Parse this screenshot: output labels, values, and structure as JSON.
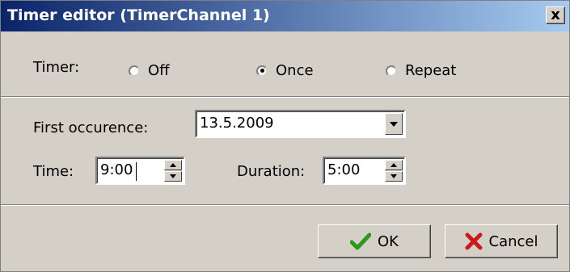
{
  "window": {
    "title": "Timer editor (TimerChannel 1)",
    "close_label": "x"
  },
  "timer": {
    "label": "Timer:",
    "options": [
      "Off",
      "Once",
      "Repeat"
    ],
    "selected": "Once"
  },
  "first_occurrence": {
    "label": "First occurence:",
    "value": "13.5.2009"
  },
  "time": {
    "label": "Time:",
    "value": "9:00"
  },
  "duration": {
    "label": "Duration:",
    "value": "5:00"
  },
  "buttons": {
    "ok_label": "OK",
    "cancel_label": "Cancel"
  },
  "colors": {
    "title_bar_start": "#0a246a",
    "title_bar_end": "#a6caf0",
    "dialog_face": "#d4d0c8",
    "ok_check": "#2a9a1a",
    "cancel_x": "#cc1a1a"
  },
  "icons": {
    "ok": "check-icon",
    "cancel": "x-icon",
    "dropdown": "chevron-down-icon",
    "spin_up": "triangle-up-icon",
    "spin_down": "triangle-down-icon"
  }
}
